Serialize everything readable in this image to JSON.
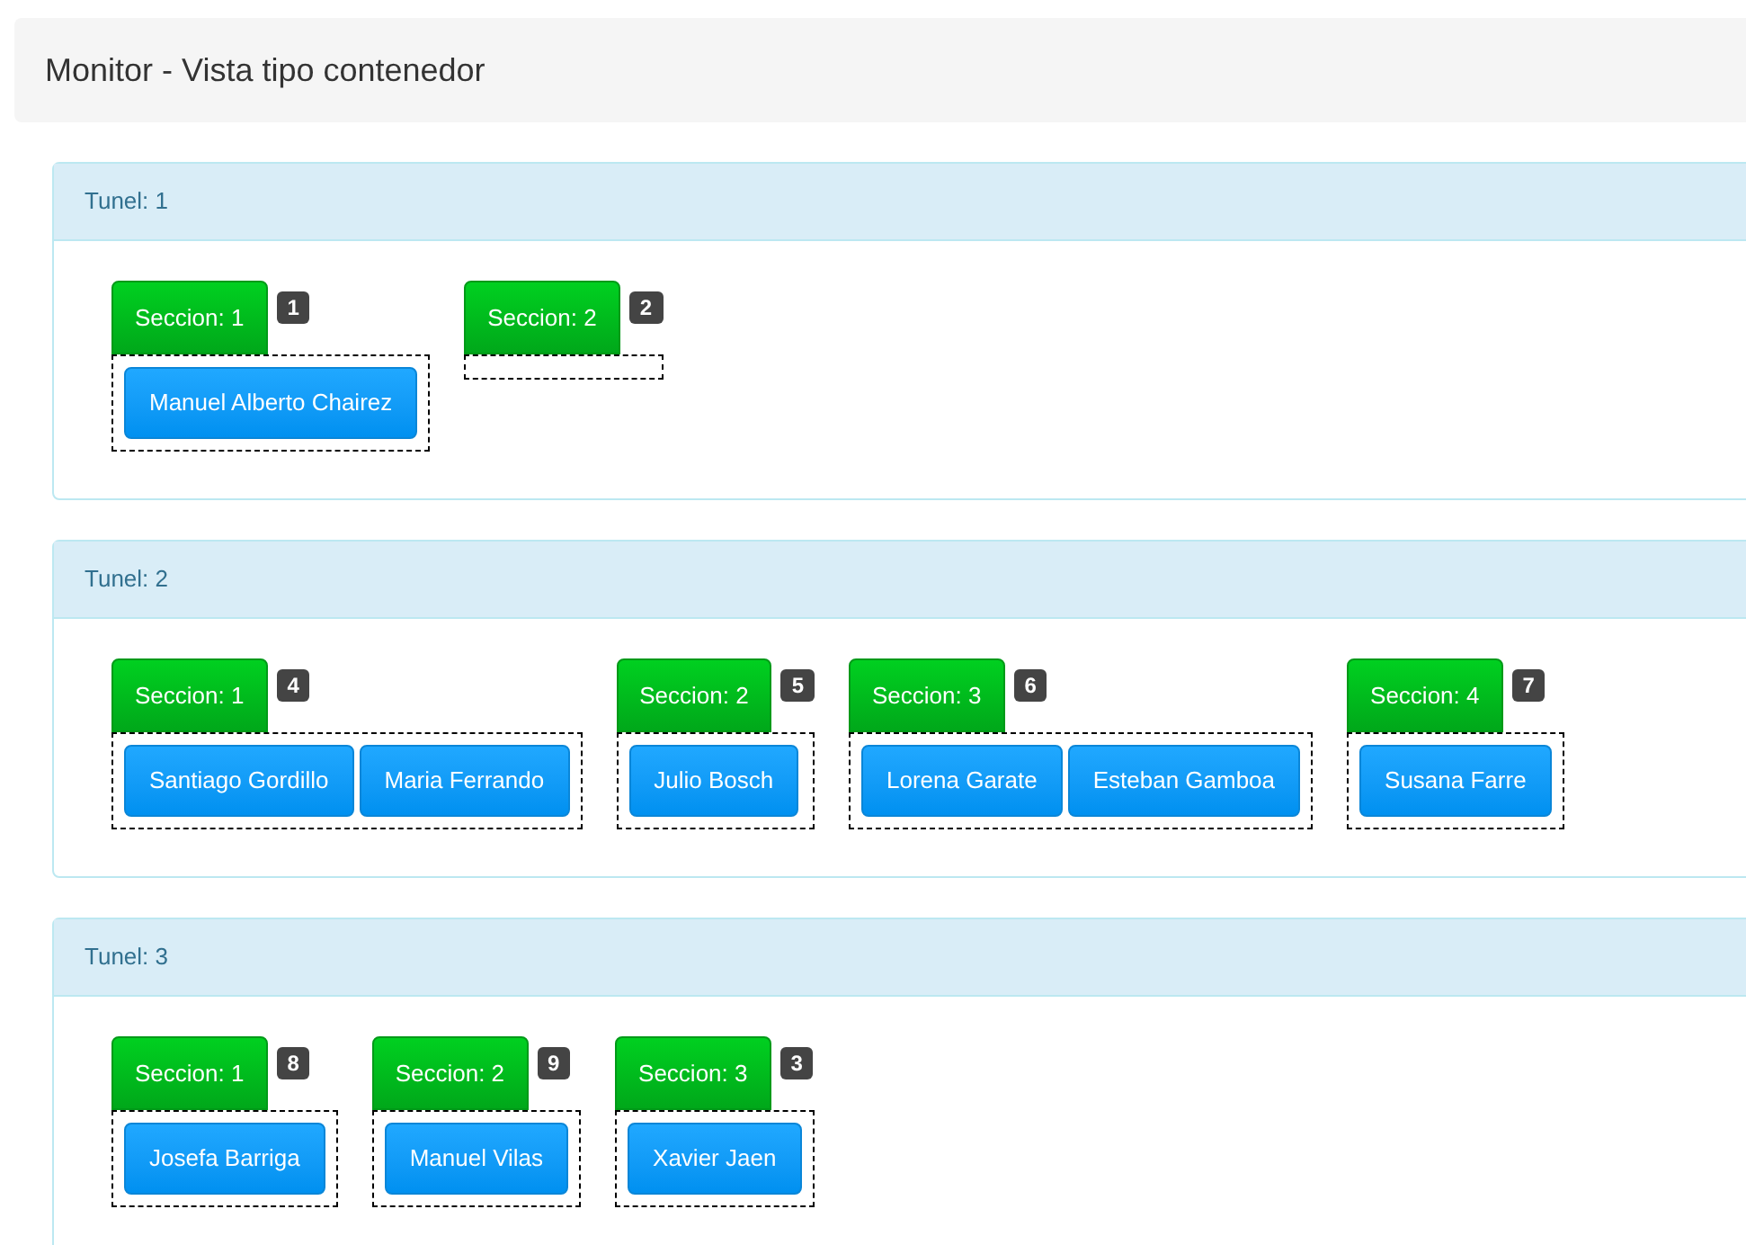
{
  "title": "Monitor - Vista tipo contenedor",
  "tunnels": [
    {
      "label": "Tunel: 1",
      "sections": [
        {
          "label": "Seccion: 1",
          "badge": "1",
          "people": [
            "Manuel Alberto Chairez"
          ]
        },
        {
          "label": "Seccion: 2",
          "badge": "2"
        }
      ]
    },
    {
      "label": "Tunel: 2",
      "sections": [
        {
          "label": "Seccion: 1",
          "badge": "4",
          "people": [
            "Santiago Gordillo",
            "Maria Ferrando"
          ]
        },
        {
          "label": "Seccion: 2",
          "badge": "5",
          "people": [
            "Julio Bosch"
          ]
        },
        {
          "label": "Seccion: 3",
          "badge": "6",
          "people": [
            "Lorena Garate",
            "Esteban Gamboa"
          ]
        },
        {
          "label": "Seccion: 4",
          "badge": "7",
          "people": [
            "Susana Farre"
          ]
        }
      ]
    },
    {
      "label": "Tunel: 3",
      "sections": [
        {
          "label": "Seccion: 1",
          "badge": "8",
          "people": [
            "Josefa Barriga"
          ]
        },
        {
          "label": "Seccion: 2",
          "badge": "9",
          "people": [
            "Manuel Vilas"
          ]
        },
        {
          "label": "Seccion: 3",
          "badge": "3",
          "people": [
            "Xavier Jaen"
          ]
        }
      ]
    }
  ]
}
